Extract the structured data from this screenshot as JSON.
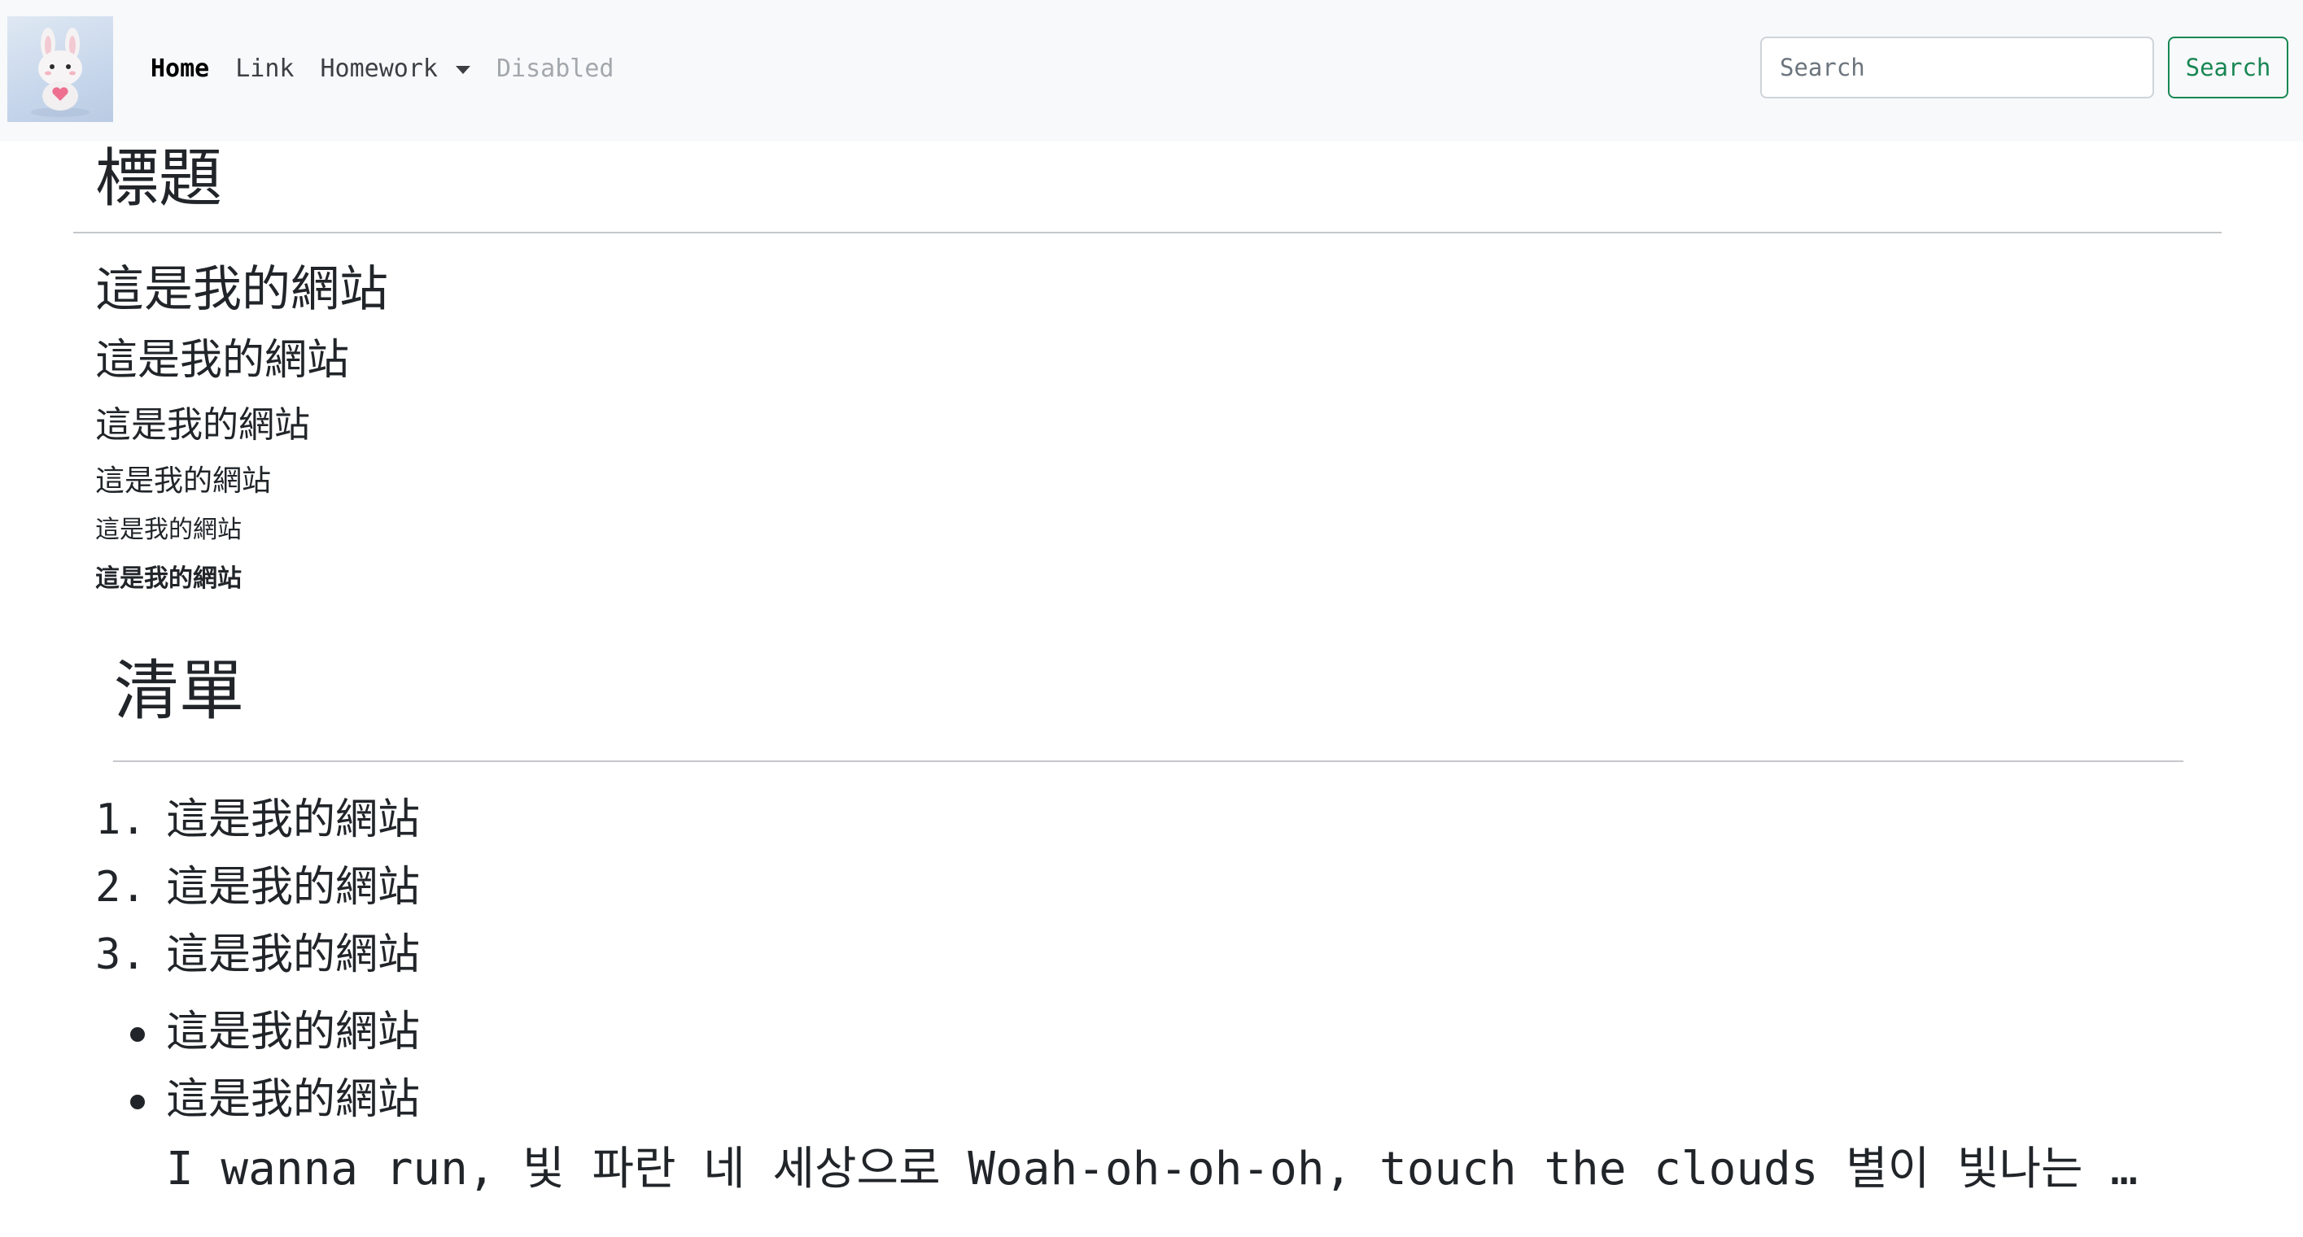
{
  "navbar": {
    "logo_alt": "site logo",
    "links": [
      {
        "label": "Home"
      },
      {
        "label": "Link"
      },
      {
        "label": "Homework"
      },
      {
        "label": "Disabled"
      }
    ],
    "search": {
      "placeholder": "Search",
      "button_label": "Search"
    }
  },
  "headings": {
    "title": "標題",
    "h1": "這是我的網站",
    "h2": "這是我的網站",
    "h3": "這是我的網站",
    "h4": "這是我的網站",
    "h5": "這是我的網站",
    "h6": "這是我的網站"
  },
  "list_section": {
    "title": "清單",
    "ordered_items": [
      {
        "num": "1.",
        "text": "這是我的網站"
      },
      {
        "num": "2.",
        "text": "這是我的網站"
      },
      {
        "num": "3.",
        "text": "這是我的網站"
      }
    ],
    "unordered_items": [
      {
        "text": "這是我的網站"
      },
      {
        "text": "這是我的網站"
      }
    ],
    "lyric": "I wanna run, 빛 파란 네 세상으로 Woah-oh-oh-oh, touch the clouds 별이 빛나는 밤의 색으로 Woah-oh-oh-oh"
  }
}
